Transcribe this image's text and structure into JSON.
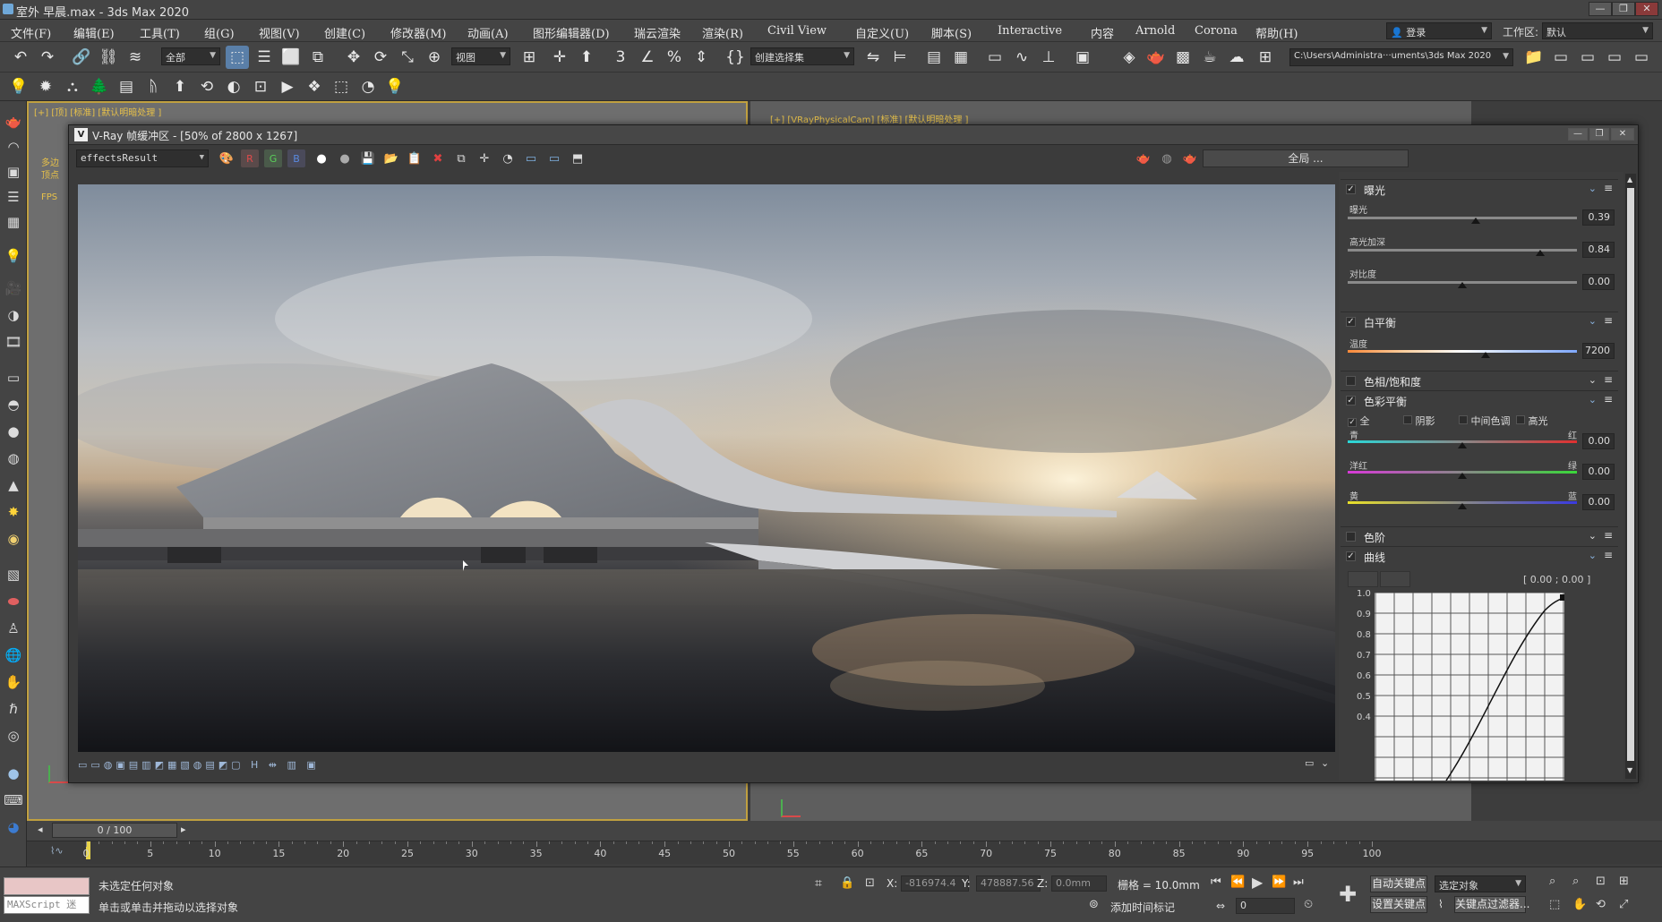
{
  "app": {
    "title": "室外  早晨.max - 3ds Max 2020",
    "window_buttons": [
      "—",
      "❐",
      "✕"
    ]
  },
  "menu": {
    "items": [
      "文件(F)",
      "编辑(E)",
      "工具(T)",
      "组(G)",
      "视图(V)",
      "创建(C)",
      "修改器(M)",
      "动画(A)",
      "图形编辑器(D)",
      "瑞云渲染",
      "渲染(R)",
      "Civil View",
      "自定义(U)",
      "脚本(S)",
      "Interactive",
      "内容",
      "Arnold",
      "Corona",
      "帮助(H)"
    ],
    "login_label": "登录",
    "workspace_label": "工作区:",
    "workspace_value": "默认"
  },
  "toolbar": {
    "selection_filter": "全部",
    "coord_system": "视图",
    "named_selection": "创建选择集",
    "project_path": "C:\\Users\\Administra···uments\\3ds Max 2020"
  },
  "viewports": {
    "left_label": "[+] [顶] [标准] [默认明暗处理 ]",
    "left_overlay_1": "多边",
    "left_overlay_2": "顶点",
    "left_overlay_3": "FPS",
    "right_label": "[+] [VRayPhysicalCam] [标准] [默认明暗处理 ]"
  },
  "vfb": {
    "title": "V-Ray 帧缓冲区 - [50% of 2800 x 1267]",
    "channel": "effectsResult",
    "channel_buttons": [
      "R",
      "G",
      "B"
    ],
    "global_label": "全局 ...",
    "exposure": {
      "title": "曝光",
      "enabled": true,
      "exposure_label": "曝光",
      "exposure_value": "0.39",
      "exposure_level": 0.56,
      "highlight_label": "高光加深",
      "highlight_value": "0.84",
      "highlight_level": 0.84,
      "contrast_label": "对比度",
      "contrast_value": "0.00",
      "contrast_level": 0.5
    },
    "white_balance": {
      "title": "白平衡",
      "enabled": true,
      "temp_label": "温度",
      "temp_value": "7200",
      "temp_level": 0.6
    },
    "hue_sat": {
      "title": "色相/饱和度",
      "enabled": false
    },
    "color_balance": {
      "title": "色彩平衡",
      "enabled": true,
      "ranges": [
        "全",
        "阴影",
        "中间色调",
        "高光"
      ],
      "cyan": "青",
      "red": "红",
      "cr_value": "0.00",
      "cr_level": 0.5,
      "magenta": "洋红",
      "green": "绿",
      "mg_value": "0.00",
      "mg_level": 0.5,
      "yellow": "黄",
      "blue": "蓝",
      "yb_value": "0.00",
      "yb_level": 0.5
    },
    "levels": {
      "title": "色阶",
      "enabled": false
    },
    "curves": {
      "title": "曲线",
      "enabled": true,
      "coords": "[ 0.00 ; 0.00 ]",
      "yticks": [
        "1.0",
        "0.9",
        "0.8",
        "0.7",
        "0.6",
        "0.5",
        "0.4"
      ]
    }
  },
  "timeline": {
    "frame": "0 / 100",
    "ticks": [
      0,
      5,
      10,
      15,
      20,
      25,
      30,
      35,
      40,
      45,
      50,
      55,
      60,
      65,
      70,
      75,
      80,
      85,
      90,
      95,
      100
    ]
  },
  "status": {
    "maxscript": "MAXScript 迷",
    "line1": "未选定任何对象",
    "line2": "单击或单击并拖动以选择对象",
    "x_label": "X:",
    "x_value": "-816974.4",
    "y_label": "Y:",
    "y_value": "478887.56",
    "z_label": "Z:",
    "z_value": "0.0mm",
    "grid": "栅格 = 10.0mm",
    "add_time_tag": "添加时间标记",
    "auto_key": "自动关键点",
    "set_key": "设置关键点",
    "key_target": "选定对象",
    "key_filter": "关键点过滤器...",
    "frame_spinner": "0"
  }
}
